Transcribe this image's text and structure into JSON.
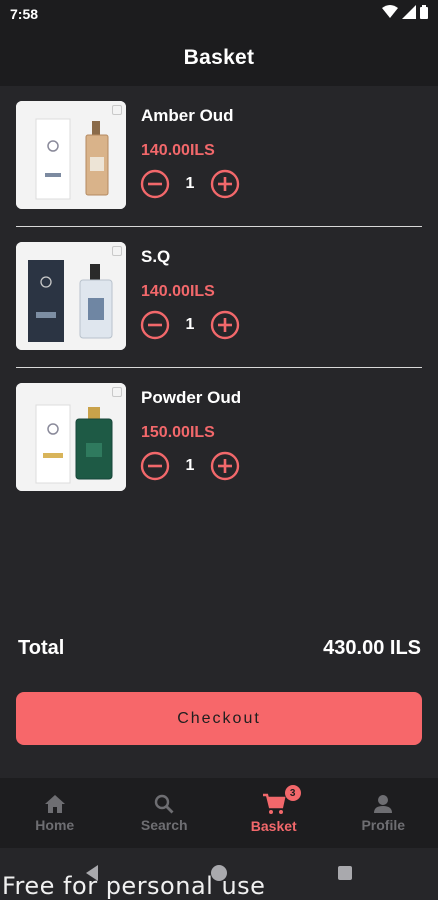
{
  "status_bar": {
    "time": "7:58"
  },
  "header": {
    "title": "Basket"
  },
  "basket": {
    "items": [
      {
        "name": "Amber Oud",
        "price": "140.00ILS",
        "quantity": "1"
      },
      {
        "name": "S.Q",
        "price": "140.00ILS",
        "quantity": "1"
      },
      {
        "name": "Powder Oud",
        "price": "150.00ILS",
        "quantity": "1"
      }
    ],
    "total_label": "Total",
    "total_value": "430.00 ILS",
    "checkout_label": "Checkout"
  },
  "bottom_nav": {
    "items": [
      {
        "label": "Home",
        "icon": "home-icon",
        "active": false
      },
      {
        "label": "Search",
        "icon": "search-icon",
        "active": false
      },
      {
        "label": "Basket",
        "icon": "cart-icon",
        "active": true,
        "badge": "3"
      },
      {
        "label": "Profile",
        "icon": "person-icon",
        "active": false
      }
    ]
  },
  "colors": {
    "accent": "#f2686b",
    "button": "#f7676a",
    "background": "#262629",
    "bar": "#1c1c1e"
  },
  "watermark": "Free for personal use"
}
